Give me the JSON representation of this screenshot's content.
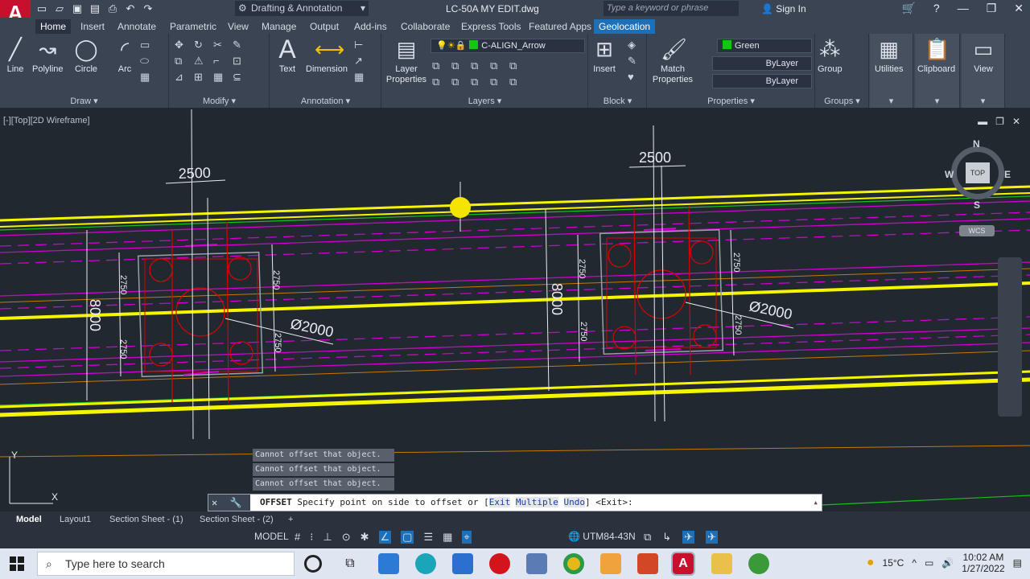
{
  "app": {
    "logo_letter": "A",
    "workspace": "Drafting & Annotation",
    "filename": "LC-50A MY EDIT.dwg",
    "search_placeholder": "Type a keyword or phrase",
    "signin": "Sign In"
  },
  "ribbon_tabs": [
    "Home",
    "Insert",
    "Annotate",
    "Parametric",
    "View",
    "Manage",
    "Output",
    "Add-ins",
    "Collaborate",
    "Express Tools",
    "Featured Apps",
    "Geolocation"
  ],
  "panels": {
    "draw": {
      "title": "Draw",
      "tools": [
        "Line",
        "Polyline",
        "Circle",
        "Arc"
      ]
    },
    "modify": {
      "title": "Modify"
    },
    "annotation": {
      "title": "Annotation",
      "tools": [
        "Text",
        "Dimension"
      ]
    },
    "layers": {
      "title": "Layers",
      "tool": "Layer Properties",
      "current_layer": "C-ALIGN_Arrow"
    },
    "block": {
      "title": "Block",
      "tool": "Insert"
    },
    "properties": {
      "title": "Properties",
      "tool": "Match Properties",
      "color": "Green",
      "linetype": "ByLayer",
      "lineweight": "ByLayer"
    },
    "groups": {
      "title": "Groups",
      "tool": "Group"
    },
    "utilities": {
      "title": "Utilities"
    },
    "clipboard": {
      "title": "Clipboard"
    },
    "view": {
      "title": "View"
    }
  },
  "viewport": {
    "label": "[-][Top][2D Wireframe]",
    "viewcube": {
      "n": "N",
      "s": "S",
      "e": "E",
      "w": "W",
      "top": "TOP",
      "wcs": "WCS"
    },
    "dims": {
      "d1": "2500",
      "d2": "2500",
      "h1": "8000",
      "h2": "8000",
      "s1": "2750",
      "s2": "2750",
      "s3": "2750",
      "s4": "2750",
      "s5": "2750",
      "s6": "2750",
      "s7": "2750",
      "s8": "2750",
      "dia1": "Ø2000",
      "dia2": "Ø2000"
    }
  },
  "command": {
    "history": [
      "Cannot offset that object.",
      "Cannot offset that object.",
      "Cannot offset that object."
    ],
    "name": "OFFSET",
    "prompt": "Specify point on side to offset or [",
    "opt1": "Exit",
    "opt2": "Multiple",
    "opt3": "Undo",
    "tail": "] <Exit>:"
  },
  "layout_tabs": [
    "Model",
    "Layout1",
    "Section Sheet - (1)",
    "Section Sheet - (2)"
  ],
  "status": {
    "model": "MODEL",
    "coord_system": "UTM84-43N"
  },
  "taskbar": {
    "search": "Type here to search",
    "temp": "15°C",
    "time": "10:02 AM",
    "date": "1/27/2022"
  },
  "colors": {
    "yellow": "#f5f500",
    "magenta": "#d000d0",
    "red": "#e00000",
    "orange": "#c87a00",
    "green": "#16c416"
  }
}
